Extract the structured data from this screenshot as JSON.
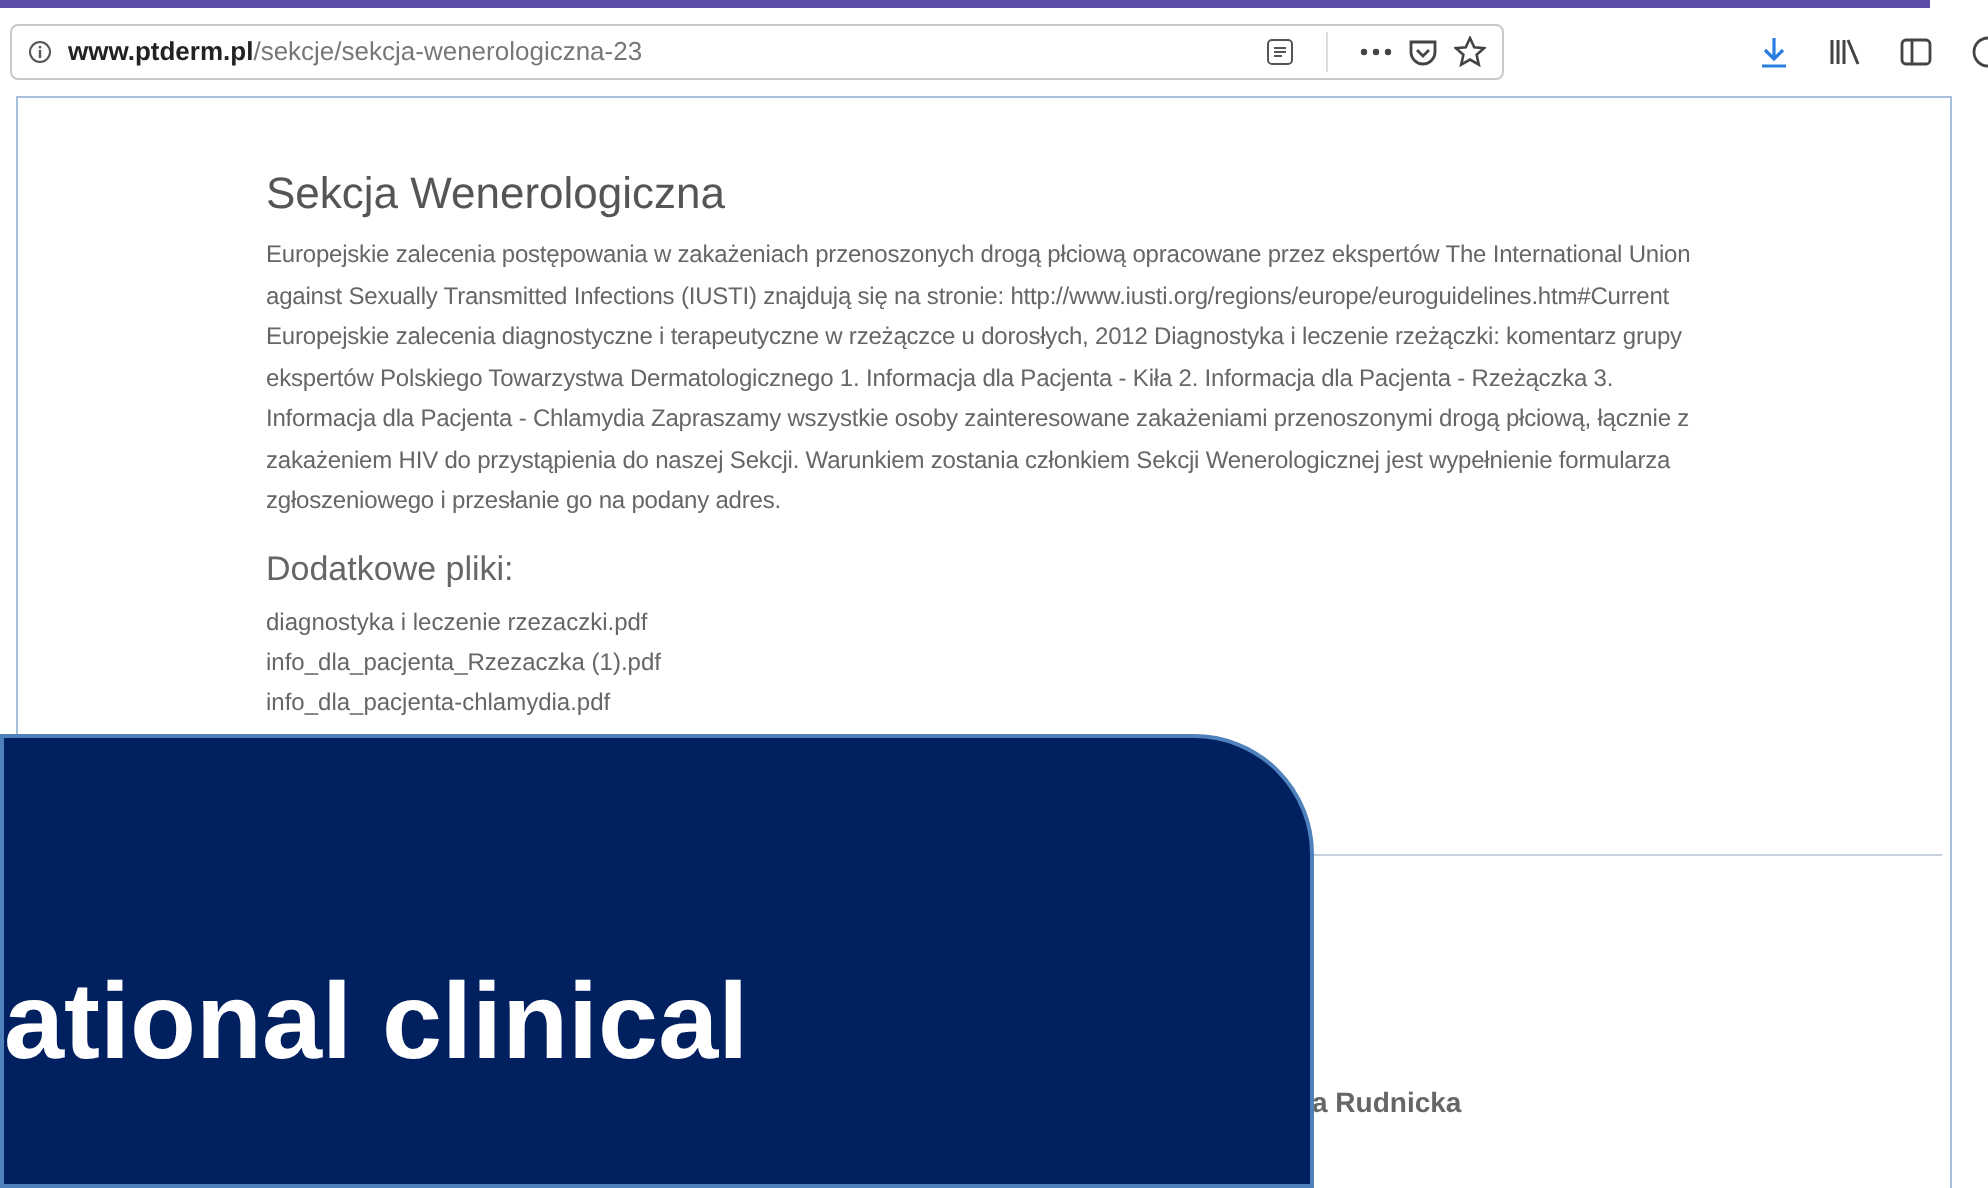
{
  "browser": {
    "url_domain": "www.ptderm.pl",
    "url_path": "/sekcje/sekcja-wenerologiczna-23"
  },
  "page": {
    "title": "Sekcja Wenerologiczna",
    "description_lines": [
      "Europejskie zalecenia postępowania w zakażeniach przenoszonych drogą płciową opracowane przez ekspertów The International Union",
      "against Sexually Transmitted Infections (IUSTI) znajdują się na stronie: http://www.iusti.org/regions/europe/euroguidelines.htm#Current",
      "Europejskie zalecenia diagnostyczne i terapeutyczne w rzeżączce u dorosłych, 2012 Diagnostyka i leczenie rzeżączki: komentarz grupy",
      "ekspertów Polskiego Towarzystwa Dermatologicznego 1. Informacja dla Pacjenta - Kiła 2. Informacja dla Pacjenta - Rzeżączka 3.",
      "Informacja dla Pacjenta - Chlamydia Zapraszamy wszystkie osoby zainteresowane zakażeniami przenoszonymi drogą płciową, łącznie z",
      "zakażeniem HIV do przystąpienia do naszej Sekcji. Warunkiem zostania członkiem Sekcji Wenerologicznej jest wypełnienie formularza",
      "zgłoszeniowego i przesłanie go na podany adres."
    ],
    "files_heading": "Dodatkowe pliki:",
    "files": [
      "diagnostyka i leczenie rzezaczki.pdf",
      "info_dla_pacjenta_Rzezaczka (1).pdf",
      "info_dla_pacjenta-chlamydia.pdf"
    ],
    "person_name": "a Rudnicka"
  },
  "overlay": {
    "lines": [
      "ational clinical"
    ]
  }
}
